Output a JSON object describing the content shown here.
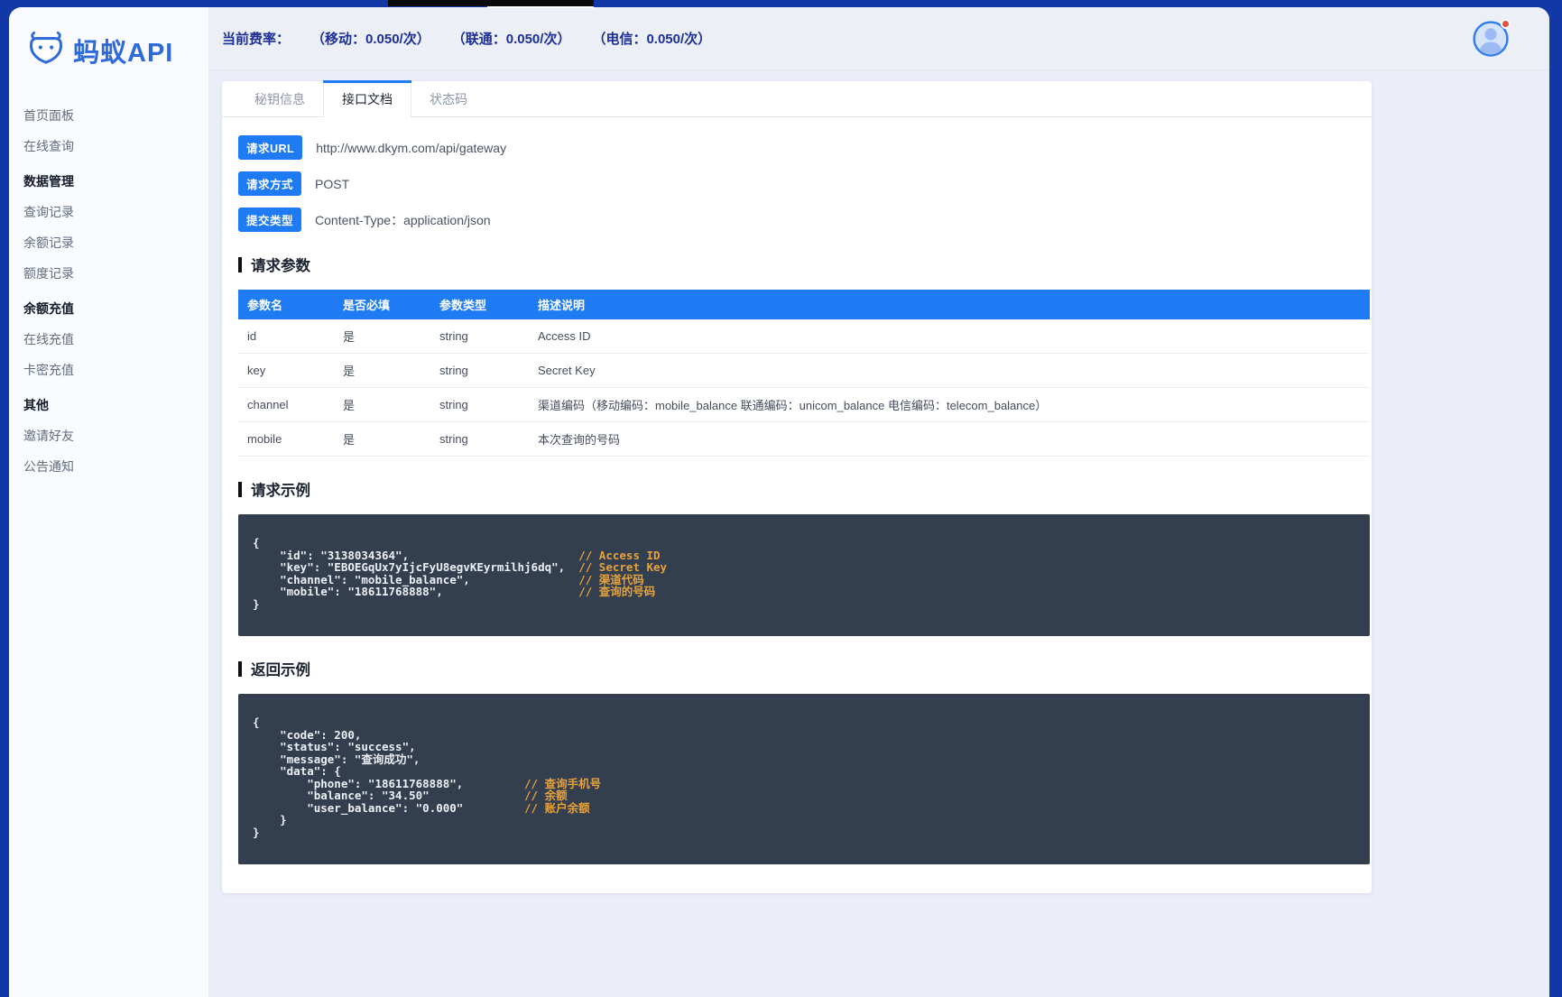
{
  "colors": {
    "frame_blue": "#1238a8",
    "accent_blue": "#1f7bf4",
    "navy_text": "#1c2e97",
    "code_background": "#333e4e",
    "code_text": "#edf0f4",
    "comment_orange": "#e6a23c",
    "notification_red": "#e8503a",
    "logo_blue": "#2e6bd8"
  },
  "sidebar": {
    "logo_text": "蚂蚁API",
    "items": [
      {
        "label": "首页面板",
        "type": "link"
      },
      {
        "label": "在线查询",
        "type": "link"
      },
      {
        "label": "数据管理",
        "type": "section"
      },
      {
        "label": "查询记录",
        "type": "link"
      },
      {
        "label": "余额记录",
        "type": "link"
      },
      {
        "label": "额度记录",
        "type": "link"
      },
      {
        "label": "余额充值",
        "type": "section"
      },
      {
        "label": "在线充值",
        "type": "link"
      },
      {
        "label": "卡密充值",
        "type": "link"
      },
      {
        "label": "其他",
        "type": "section"
      },
      {
        "label": "邀请好友",
        "type": "link"
      },
      {
        "label": "公告通知",
        "type": "link"
      }
    ]
  },
  "topbar": {
    "rate_label": "当前费率：",
    "rates": [
      "（移动：0.050/次）",
      "（联通：0.050/次）",
      "（电信：0.050/次）"
    ]
  },
  "tabs": [
    {
      "label": "秘钥信息",
      "active": false
    },
    {
      "label": "接口文档",
      "active": true
    },
    {
      "label": "状态码",
      "active": false
    }
  ],
  "request_info": [
    {
      "badge": "请求URL",
      "value": "http://www.dkym.com/api/gateway"
    },
    {
      "badge": "请求方式",
      "value": "POST"
    },
    {
      "badge": "提交类型",
      "value": "Content-Type：application/json"
    }
  ],
  "params_section": {
    "title": "请求参数",
    "headers": [
      "参数名",
      "是否必填",
      "参数类型",
      "描述说明"
    ],
    "rows": [
      [
        "id",
        "是",
        "string",
        "Access ID"
      ],
      [
        "key",
        "是",
        "string",
        "Secret Key"
      ],
      [
        "channel",
        "是",
        "string",
        "渠道编码（移动编码：mobile_balance 联通编码：unicom_balance 电信编码：telecom_balance）"
      ],
      [
        "mobile",
        "是",
        "string",
        "本次查询的号码"
      ]
    ]
  },
  "request_example": {
    "title": "请求示例",
    "comment_col": 48,
    "lines": [
      {
        "code": "{"
      },
      {
        "code": "    \"id\": \"3138034364\",",
        "comment": "// Access ID"
      },
      {
        "code": "    \"key\": \"EBOEGqUx7yIjcFyU8egvKEyrmilhj6dq\",",
        "comment": "// Secret Key"
      },
      {
        "code": "    \"channel\": \"mobile_balance\",",
        "comment": "// 渠道代码"
      },
      {
        "code": "    \"mobile\": \"18611768888\",",
        "comment": "// 查询的号码"
      },
      {
        "code": "}"
      }
    ]
  },
  "response_example": {
    "title": "返回示例",
    "comment_col": 40,
    "lines": [
      {
        "code": "{"
      },
      {
        "code": "    \"code\": 200,"
      },
      {
        "code": "    \"status\": \"success\","
      },
      {
        "code": "    \"message\": \"查询成功\","
      },
      {
        "code": "    \"data\": {"
      },
      {
        "code": "        \"phone\": \"18611768888\",",
        "comment": "// 查询手机号"
      },
      {
        "code": "        \"balance\": \"34.50\"",
        "comment": "// 余额"
      },
      {
        "code": "        \"user_balance\": \"0.000\"",
        "comment": "// 账户余额"
      },
      {
        "code": "    }"
      },
      {
        "code": "}"
      }
    ]
  }
}
